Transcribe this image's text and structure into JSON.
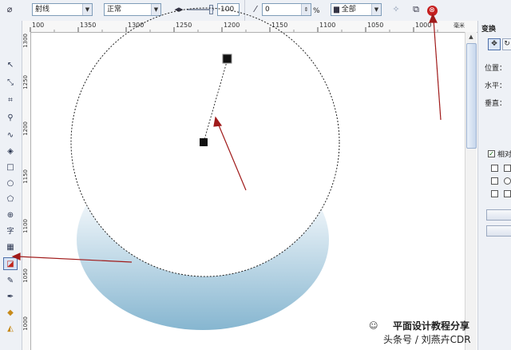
{
  "propbar": {
    "font_combo": "射线",
    "mode_combo": "正常",
    "slider_value": "100",
    "rotation_value": "0",
    "percent_label": "%",
    "range_combo": "全部"
  },
  "ruler": {
    "h_labels": [
      "100",
      "1350",
      "1300",
      "1250",
      "1200",
      "1150",
      "1100",
      "1050",
      "1000",
      "毫米"
    ],
    "v_labels": [
      "1300",
      "1250",
      "1200",
      "1150",
      "1100",
      "1050",
      "1000"
    ]
  },
  "docker": {
    "tab_title": "变换",
    "position_label": "位置：",
    "horizontal_label": "水平：",
    "vertical_label": "垂直：",
    "relative_label": "相对"
  },
  "watermark": {
    "line1": "平面设计教程分享",
    "line2": "头条号 / 刘燕卉CDR"
  },
  "colors": {
    "annotation_arrow": "#a01a1a",
    "shadow_gradient_top": "#f4f8fb",
    "shadow_gradient_bottom": "#8ab9d2",
    "chrome": "#eef1f6"
  },
  "icons": {
    "toolbox": [
      "pointer-icon",
      "shape-icon",
      "crop-icon",
      "zoom-icon",
      "freehand-icon",
      "smart-fill-icon",
      "rectangle-icon",
      "ellipse-icon",
      "polygon-icon",
      "basic-shapes-icon",
      "text-icon",
      "table-icon",
      "interactive-shadow-icon",
      "eyedropper-icon",
      "outline-pen-icon",
      "fill-icon",
      "interactive-fill-icon"
    ]
  }
}
